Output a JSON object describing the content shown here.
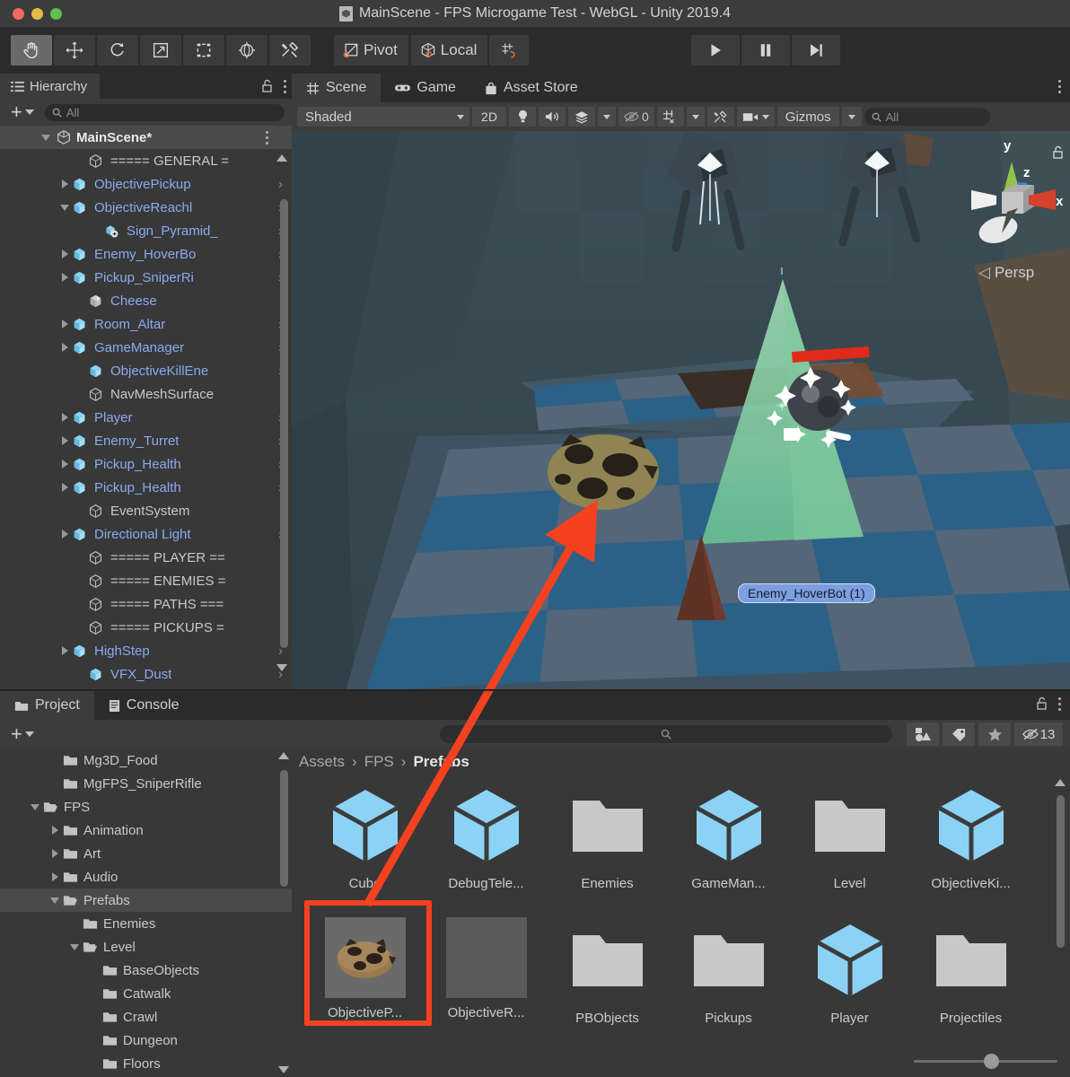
{
  "window": {
    "title": "MainScene - FPS Microgame Test - WebGL - Unity 2019.4",
    "app_icon": "unity-scene-icon"
  },
  "toolbar": {
    "tools": [
      {
        "name": "hand-tool",
        "icon": "hand-icon",
        "active": true
      },
      {
        "name": "move-tool",
        "icon": "move-arrows-icon",
        "active": false
      },
      {
        "name": "rotate-tool",
        "icon": "rotate-icon",
        "active": false
      },
      {
        "name": "scale-tool",
        "icon": "scale-icon",
        "active": false
      },
      {
        "name": "rect-tool",
        "icon": "rect-transform-icon",
        "active": false
      },
      {
        "name": "transform-tool",
        "icon": "move-rotate-scale-icon",
        "active": false
      },
      {
        "name": "custom-tool",
        "icon": "wrench-screwdriver-icon",
        "active": false
      }
    ],
    "pivot_label": "Pivot",
    "local_label": "Local",
    "snap_icon": "grid-snap-icon",
    "play_label": "play-icon",
    "pause_label": "pause-icon",
    "step_label": "step-icon"
  },
  "hierarchy": {
    "tab_label": "Hierarchy",
    "tab_icon": "hierarchy-icon",
    "lock_icon": "lock-open-icon",
    "menu_icon": "kebab-menu-icon",
    "add_label": "+",
    "search_placeholder": "All",
    "scene_name": "MainScene*",
    "items": [
      {
        "label": "===== GENERAL =",
        "indent": 2,
        "twisty": "none",
        "icon": "gameobject",
        "prefab": false,
        "chevron": false
      },
      {
        "label": "ObjectivePickup",
        "indent": 1,
        "twisty": "right",
        "icon": "prefab",
        "prefab": true,
        "chevron": true
      },
      {
        "label": "ObjectiveReachl",
        "indent": 1,
        "twisty": "down",
        "icon": "prefab",
        "prefab": true,
        "chevron": true
      },
      {
        "label": "Sign_Pyramid_",
        "indent": 3,
        "twisty": "none",
        "icon": "prefab-variant",
        "prefab": true,
        "chevron": true
      },
      {
        "label": "Enemy_HoverBo",
        "indent": 1,
        "twisty": "right",
        "icon": "prefab",
        "prefab": true,
        "chevron": true
      },
      {
        "label": "Pickup_SniperRi",
        "indent": 1,
        "twisty": "right",
        "icon": "prefab",
        "prefab": true,
        "chevron": true
      },
      {
        "label": "Cheese",
        "indent": 2,
        "twisty": "none",
        "icon": "prefab-broken",
        "prefab": true,
        "chevron": false
      },
      {
        "label": "Room_Altar",
        "indent": 1,
        "twisty": "right",
        "icon": "prefab",
        "prefab": true,
        "chevron": true
      },
      {
        "label": "GameManager",
        "indent": 1,
        "twisty": "right",
        "icon": "prefab",
        "prefab": true,
        "chevron": true
      },
      {
        "label": "ObjectiveKillEne",
        "indent": 2,
        "twisty": "none",
        "icon": "prefab",
        "prefab": true,
        "chevron": true
      },
      {
        "label": "NavMeshSurface",
        "indent": 2,
        "twisty": "none",
        "icon": "gameobject",
        "prefab": false,
        "chevron": false
      },
      {
        "label": "Player",
        "indent": 1,
        "twisty": "right",
        "icon": "prefab",
        "prefab": true,
        "chevron": true
      },
      {
        "label": "Enemy_Turret",
        "indent": 1,
        "twisty": "right",
        "icon": "prefab",
        "prefab": true,
        "chevron": true
      },
      {
        "label": "Pickup_Health",
        "indent": 1,
        "twisty": "right",
        "icon": "prefab",
        "prefab": true,
        "chevron": true
      },
      {
        "label": "Pickup_Health",
        "indent": 1,
        "twisty": "right",
        "icon": "prefab",
        "prefab": true,
        "chevron": true
      },
      {
        "label": "EventSystem",
        "indent": 2,
        "twisty": "none",
        "icon": "gameobject",
        "prefab": false,
        "chevron": false
      },
      {
        "label": "Directional Light",
        "indent": 1,
        "twisty": "right",
        "icon": "prefab",
        "prefab": true,
        "chevron": true
      },
      {
        "label": "===== PLAYER ==",
        "indent": 2,
        "twisty": "none",
        "icon": "gameobject",
        "prefab": false,
        "chevron": false
      },
      {
        "label": "===== ENEMIES =",
        "indent": 2,
        "twisty": "none",
        "icon": "gameobject",
        "prefab": false,
        "chevron": false
      },
      {
        "label": "===== PATHS ===",
        "indent": 2,
        "twisty": "none",
        "icon": "gameobject",
        "prefab": false,
        "chevron": false
      },
      {
        "label": "===== PICKUPS =",
        "indent": 2,
        "twisty": "none",
        "icon": "gameobject",
        "prefab": false,
        "chevron": false
      },
      {
        "label": "HighStep",
        "indent": 1,
        "twisty": "right",
        "icon": "prefab",
        "prefab": true,
        "chevron": true
      },
      {
        "label": "VFX_Dust",
        "indent": 2,
        "twisty": "none",
        "icon": "prefab",
        "prefab": true,
        "chevron": true
      }
    ]
  },
  "scene": {
    "tabs": [
      {
        "label": "Scene",
        "icon": "scene-grid-icon",
        "active": true
      },
      {
        "label": "Game",
        "icon": "gamepad-icon",
        "active": false
      },
      {
        "label": "Asset Store",
        "icon": "shopping-bag-icon",
        "active": false
      }
    ],
    "menu_icon": "kebab-menu-icon",
    "toolbar": {
      "draw_mode": "Shaded",
      "two_d": "2D",
      "lighting_icon": "lightbulb-icon",
      "audio_icon": "speaker-icon",
      "fx_icon": "fx-layers-icon",
      "hidden_count": "0",
      "hidden_icon": "eye-slash-icon",
      "grid_icon": "grid-visibility-icon",
      "component_icon": "tools-icon",
      "camera_icon": "camera-icon",
      "gizmos_label": "Gizmos",
      "search_placeholder": "All"
    },
    "gizmo": {
      "x_label": "x",
      "y_label": "y",
      "z_label": "z",
      "projection": "Persp",
      "lock_icon": "lock-open-icon"
    },
    "selected_object_label": "Enemy_HoverBot (1)",
    "colors": {
      "wall": "#35474f",
      "floor_blue": "#1d5580",
      "floor_gray": "#4a5d6b",
      "pyramid_green": "#7ec99a",
      "annotation_red": "#f4411f"
    }
  },
  "project": {
    "tabs": [
      {
        "label": "Project",
        "icon": "folder-icon",
        "active": true
      },
      {
        "label": "Console",
        "icon": "console-icon",
        "active": false
      }
    ],
    "lock_icon": "lock-open-icon",
    "menu_icon": "kebab-menu-icon",
    "add_label": "+",
    "search_placeholder": "",
    "search_icon": "search-icon",
    "filter_type_icon": "filter-by-type-icon",
    "filter_label_icon": "filter-by-label-icon",
    "favorites_icon": "star-icon",
    "hidden_icon": "eye-slash-icon",
    "hidden_count": "13",
    "tree": [
      {
        "label": "Mg3D_Food",
        "indent": 2,
        "twisty": "none",
        "open": false,
        "selected": false
      },
      {
        "label": "MgFPS_SniperRifle",
        "indent": 2,
        "twisty": "none",
        "open": false,
        "selected": false
      },
      {
        "label": "FPS",
        "indent": 1,
        "twisty": "down",
        "open": true,
        "selected": false
      },
      {
        "label": "Animation",
        "indent": 2,
        "twisty": "right",
        "open": false,
        "selected": false
      },
      {
        "label": "Art",
        "indent": 2,
        "twisty": "right",
        "open": false,
        "selected": false
      },
      {
        "label": "Audio",
        "indent": 2,
        "twisty": "right",
        "open": false,
        "selected": false
      },
      {
        "label": "Prefabs",
        "indent": 2,
        "twisty": "down",
        "open": true,
        "selected": true
      },
      {
        "label": "Enemies",
        "indent": 3,
        "twisty": "none",
        "open": false,
        "selected": false
      },
      {
        "label": "Level",
        "indent": 3,
        "twisty": "down",
        "open": true,
        "selected": false
      },
      {
        "label": "BaseObjects",
        "indent": 4,
        "twisty": "none",
        "open": false,
        "selected": false
      },
      {
        "label": "Catwalk",
        "indent": 4,
        "twisty": "none",
        "open": false,
        "selected": false
      },
      {
        "label": "Crawl",
        "indent": 4,
        "twisty": "none",
        "open": false,
        "selected": false
      },
      {
        "label": "Dungeon",
        "indent": 4,
        "twisty": "none",
        "open": false,
        "selected": false
      },
      {
        "label": "Floors",
        "indent": 4,
        "twisty": "none",
        "open": false,
        "selected": false
      }
    ],
    "breadcrumb": [
      "Assets",
      "FPS",
      "Prefabs"
    ],
    "assets": [
      {
        "label": "Cube",
        "kind": "prefab",
        "selected": false
      },
      {
        "label": "DebugTele...",
        "kind": "prefab",
        "selected": false
      },
      {
        "label": "Enemies",
        "kind": "folder",
        "selected": false
      },
      {
        "label": "GameMan...",
        "kind": "prefab",
        "selected": false
      },
      {
        "label": "Level",
        "kind": "folder",
        "selected": false
      },
      {
        "label": "ObjectiveKi...",
        "kind": "prefab",
        "selected": false
      },
      {
        "label": "ObjectiveP...",
        "kind": "thumbnail-cookie",
        "selected": true
      },
      {
        "label": "ObjectiveR...",
        "kind": "thumbnail-blank",
        "selected": false
      },
      {
        "label": "PBObjects",
        "kind": "folder",
        "selected": false
      },
      {
        "label": "Pickups",
        "kind": "folder",
        "selected": false
      },
      {
        "label": "Player",
        "kind": "prefab",
        "selected": false
      },
      {
        "label": "Projectiles",
        "kind": "folder",
        "selected": false
      }
    ]
  }
}
